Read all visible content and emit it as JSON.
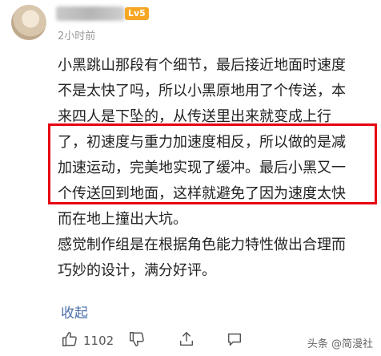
{
  "user": {
    "level_badge": "Lv5"
  },
  "comment": {
    "time": "2小时前",
    "lines": [
      "小黑跳山那段有个细节，最后接近地面时速度",
      "不是太快了吗，所以小黑原地用了个传送，本",
      "来四人是下坠的，从传送里出来就变成上行",
      "了，初速度与重力加速度相反，所以做的是减",
      "加速运动，完美地实现了缓冲。最后小黑又一",
      "个传送回到地面，这样就避免了因为速度太快",
      "而在地上撞出大坑。",
      "感觉制作组是在根据角色能力特性做出合理而",
      "巧妙的设计，满分好评。"
    ],
    "collapse_label": "收起"
  },
  "actions": {
    "like_count": "1102"
  },
  "watermark": "头条 @简漫社",
  "colors": {
    "highlight": "#e60012",
    "link": "#4a6ea9",
    "badge": "#f6a623"
  }
}
